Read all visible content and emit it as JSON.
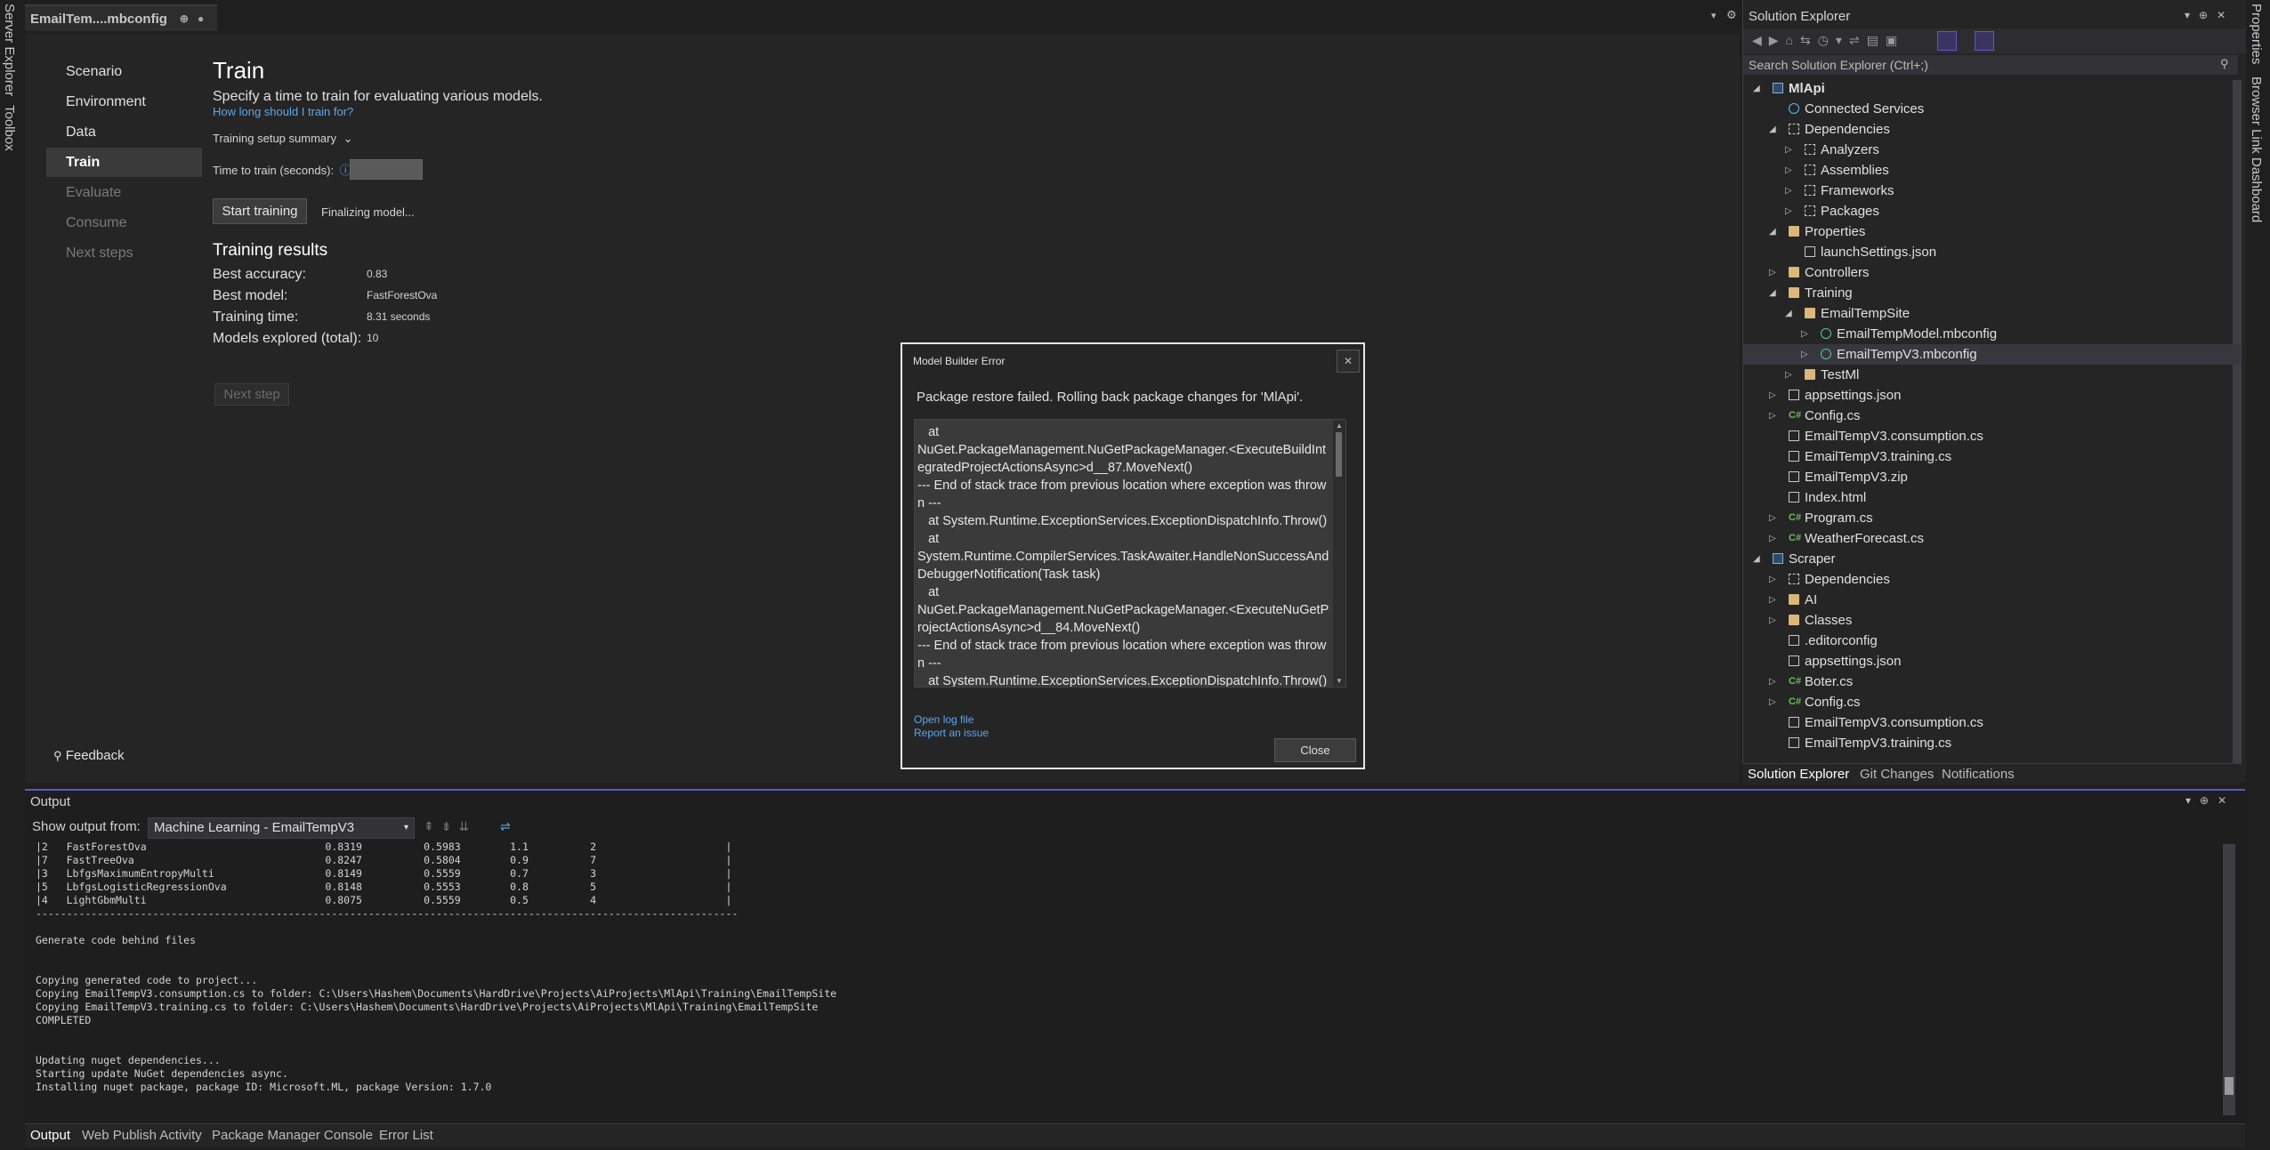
{
  "left_strip": {
    "items": [
      "Server Explorer",
      "Toolbox"
    ]
  },
  "right_strip": {
    "items": [
      "Properties",
      "Browser Link Dashboard"
    ]
  },
  "doc_tab": {
    "title": "EmailTem....mbconfig",
    "pin": "⊕",
    "close": "●"
  },
  "doc_tabbar_icons": {
    "dropdown": "▾",
    "settings": "⚙"
  },
  "editor": {
    "nav": [
      {
        "label": "Scenario",
        "state": "normal"
      },
      {
        "label": "Environment",
        "state": "normal"
      },
      {
        "label": "Data",
        "state": "normal"
      },
      {
        "label": "Train",
        "state": "active"
      },
      {
        "label": "Evaluate",
        "state": "disabled"
      },
      {
        "label": "Consume",
        "state": "disabled"
      },
      {
        "label": "Next steps",
        "state": "disabled"
      }
    ],
    "title": "Train",
    "subtitle": "Specify a time to train for evaluating various models.",
    "help_link": "How long should I train for?",
    "summary_toggle": "Training setup summary",
    "time_label": "Time to train (seconds):",
    "time_value": "",
    "start_button": "Start training",
    "status": "Finalizing model...",
    "results_title": "Training results",
    "results": [
      {
        "label": "Best accuracy:",
        "value": "0.83"
      },
      {
        "label": "Best model:",
        "value": "FastForestOva"
      },
      {
        "label": "Training time:",
        "value": "8.31 seconds"
      },
      {
        "label": "Models explored (total):",
        "value": "10"
      }
    ],
    "next_button": "Next step",
    "feedback": "Feedback"
  },
  "solution_explorer": {
    "title": "Solution Explorer",
    "search_placeholder": "Search Solution Explorer (Ctrl+;)",
    "tree": [
      {
        "label": "MlApi",
        "depth": 0,
        "arrow": "◢",
        "icon": "proj",
        "bold": true
      },
      {
        "label": "Connected Services",
        "depth": 1,
        "arrow": "",
        "icon": "globe"
      },
      {
        "label": "Dependencies",
        "depth": 1,
        "arrow": "◢",
        "icon": "dep"
      },
      {
        "label": "Analyzers",
        "depth": 2,
        "arrow": "▷",
        "icon": "dep"
      },
      {
        "label": "Assemblies",
        "depth": 2,
        "arrow": "▷",
        "icon": "dep"
      },
      {
        "label": "Frameworks",
        "depth": 2,
        "arrow": "▷",
        "icon": "dep"
      },
      {
        "label": "Packages",
        "depth": 2,
        "arrow": "▷",
        "icon": "dep"
      },
      {
        "label": "Properties",
        "depth": 1,
        "arrow": "◢",
        "icon": "folder"
      },
      {
        "label": "launchSettings.json",
        "depth": 2,
        "arrow": "",
        "icon": "file"
      },
      {
        "label": "Controllers",
        "depth": 1,
        "arrow": "▷",
        "icon": "folder"
      },
      {
        "label": "Training",
        "depth": 1,
        "arrow": "◢",
        "icon": "folder"
      },
      {
        "label": "EmailTempSite",
        "depth": 2,
        "arrow": "◢",
        "icon": "folder"
      },
      {
        "label": "EmailTempModel.mbconfig",
        "depth": 3,
        "arrow": "▷",
        "icon": "gear"
      },
      {
        "label": "EmailTempV3.mbconfig",
        "depth": 3,
        "arrow": "▷",
        "icon": "gear",
        "selected": true
      },
      {
        "label": "TestMl",
        "depth": 2,
        "arrow": "▷",
        "icon": "folder"
      },
      {
        "label": "appsettings.json",
        "depth": 1,
        "arrow": "▷",
        "icon": "file"
      },
      {
        "label": "Config.cs",
        "depth": 1,
        "arrow": "▷",
        "icon": "cs"
      },
      {
        "label": "EmailTempV3.consumption.cs",
        "depth": 1,
        "arrow": "",
        "icon": "file"
      },
      {
        "label": "EmailTempV3.training.cs",
        "depth": 1,
        "arrow": "",
        "icon": "file"
      },
      {
        "label": "EmailTempV3.zip",
        "depth": 1,
        "arrow": "",
        "icon": "file"
      },
      {
        "label": "Index.html",
        "depth": 1,
        "arrow": "",
        "icon": "file"
      },
      {
        "label": "Program.cs",
        "depth": 1,
        "arrow": "▷",
        "icon": "cs"
      },
      {
        "label": "WeatherForecast.cs",
        "depth": 1,
        "arrow": "▷",
        "icon": "cs"
      },
      {
        "label": "Scraper",
        "depth": 0,
        "arrow": "◢",
        "icon": "proj"
      },
      {
        "label": "Dependencies",
        "depth": 1,
        "arrow": "▷",
        "icon": "dep"
      },
      {
        "label": "AI",
        "depth": 1,
        "arrow": "▷",
        "icon": "folder"
      },
      {
        "label": "Classes",
        "depth": 1,
        "arrow": "▷",
        "icon": "folder"
      },
      {
        "label": ".editorconfig",
        "depth": 1,
        "arrow": "",
        "icon": "file"
      },
      {
        "label": "appsettings.json",
        "depth": 1,
        "arrow": "",
        "icon": "file"
      },
      {
        "label": "Boter.cs",
        "depth": 1,
        "arrow": "▷",
        "icon": "cs"
      },
      {
        "label": "Config.cs",
        "depth": 1,
        "arrow": "▷",
        "icon": "cs"
      },
      {
        "label": "EmailTempV3.consumption.cs",
        "depth": 1,
        "arrow": "",
        "icon": "file"
      },
      {
        "label": "EmailTempV3.training.cs",
        "depth": 1,
        "arrow": "",
        "icon": "file"
      }
    ],
    "tabs": [
      "Solution Explorer",
      "Git Changes",
      "Notifications"
    ]
  },
  "modal": {
    "title": "Model Builder Error",
    "close_x": "✕",
    "message": "Package restore failed. Rolling back package changes for 'MlApi'.",
    "stack_trace": "   at\nNuGet.PackageManagement.NuGetPackageManager.<ExecuteBuildIntegratedProjectActionsAsync>d__87.MoveNext()\n--- End of stack trace from previous location where exception was thrown ---\n   at System.Runtime.ExceptionServices.ExceptionDispatchInfo.Throw()\n   at\nSystem.Runtime.CompilerServices.TaskAwaiter.HandleNonSuccessAndDebuggerNotification(Task task)\n   at\nNuGet.PackageManagement.NuGetPackageManager.<ExecuteNuGetProjectActionsAsync>d__84.MoveNext()\n--- End of stack trace from previous location where exception was thrown ---\n   at System.Runtime.ExceptionServices.ExceptionDispatchInfo.Throw()",
    "open_log": "Open log file",
    "report_issue": "Report an issue",
    "close_button": "Close"
  },
  "output": {
    "title": "Output",
    "show_from_label": "Show output from:",
    "source": "Machine Learning - EmailTempV3",
    "text": "|2   FastForestOva                             0.8319          0.5983        1.1          2                     |\n|7   FastTreeOva                               0.8247          0.5804        0.9          7                     |\n|3   LbfgsMaximumEntropyMulti                  0.8149          0.5559        0.7          3                     |\n|5   LbfgsLogisticRegressionOva                0.8148          0.5553        0.8          5                     |\n|4   LightGbmMulti                             0.8075          0.5559        0.5          4                     |\n------------------------------------------------------------------------------------------------------------------\n\nGenerate code behind files\n\n\nCopying generated code to project...\nCopying EmailTempV3.consumption.cs to folder: C:\\Users\\Hashem\\Documents\\HardDrive\\Projects\\AiProjects\\MlApi\\Training\\EmailTempSite\nCopying EmailTempV3.training.cs to folder: C:\\Users\\Hashem\\Documents\\HardDrive\\Projects\\AiProjects\\MlApi\\Training\\EmailTempSite\nCOMPLETED\n\n\nUpdating nuget dependencies...\nStarting update NuGet dependencies async.\nInstalling nuget package, package ID: Microsoft.ML, package Version: 1.7.0",
    "tabs": [
      "Output",
      "Web Publish Activity",
      "Package Manager Console",
      "Error List"
    ]
  },
  "colors": {
    "accent": "#5d57c8",
    "link": "#5ea6ea",
    "background": "#1f1f1f"
  }
}
